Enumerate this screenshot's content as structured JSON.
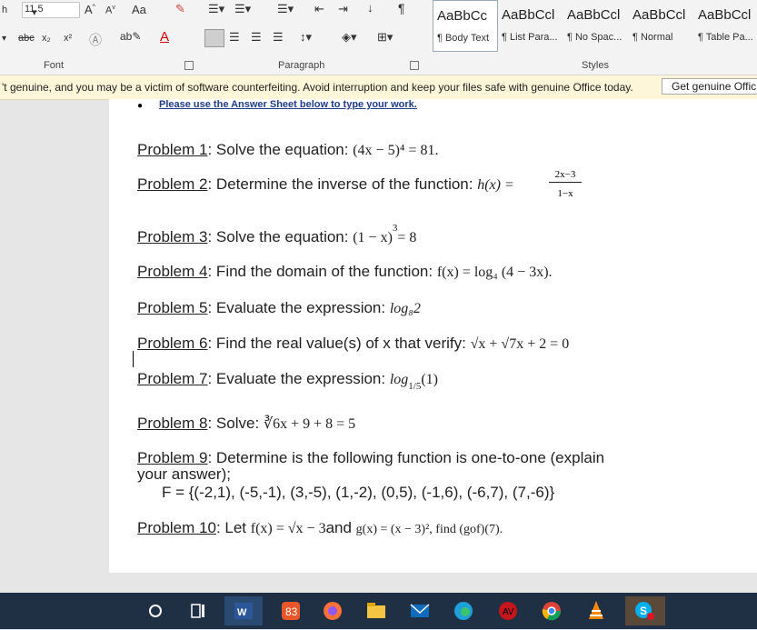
{
  "ribbon": {
    "font_size": "11.5",
    "aa_label": "Aa",
    "groups": {
      "font": "Font",
      "paragraph": "Paragraph",
      "styles": "Styles"
    },
    "styles": [
      {
        "preview": "AaBbCc",
        "name": "¶ Body Text"
      },
      {
        "preview": "AaBbCcl",
        "name": "¶ List Para..."
      },
      {
        "preview": "AaBbCcl",
        "name": "¶ No Spac..."
      },
      {
        "preview": "AaBbCcl",
        "name": "¶ Normal"
      },
      {
        "preview": "AaBbCcl",
        "name": "¶ Table Pa..."
      }
    ],
    "font_buttons": {
      "strike": "abc",
      "sub": "x₂",
      "sup": "x²",
      "font_color": "A"
    }
  },
  "message_bar": {
    "text": "'t genuine, and you may be a victim of software counterfeiting. Avoid interruption and keep your files safe with genuine Office today.",
    "button": "Get genuine Offic"
  },
  "document": {
    "instruction": "Please use the Answer Sheet below to type your work.",
    "problems": [
      {
        "label": "Problem 1",
        "text": ": Solve the equation: ",
        "math": "(4x − 5)⁴ = 81."
      },
      {
        "label": "Problem 2",
        "text": ": Determine the inverse of the function: ",
        "math": "h(x) =",
        "numerator": "2x−3",
        "denominator": "1−x"
      },
      {
        "label": "Problem 3",
        "text": ": Solve the equation: ",
        "math": "(1 − x)",
        "exponent": "3",
        "math2": "= 8"
      },
      {
        "label": "Problem 4",
        "text": ": Find the domain of the function: ",
        "math": "f(x) = log₄ (4 − 3x)."
      },
      {
        "label": "Problem 5",
        "text": ": Evaluate the expression: ",
        "math": "log₈2"
      },
      {
        "label": "Problem 6",
        "text": ": Find the real value(s) of x that verify: ",
        "math": "√x + √7x + 2 = 0"
      },
      {
        "label": "Problem 7",
        "text": ": Evaluate the expression: ",
        "math": "log",
        "subscript": "1/5",
        "math2": "(1)"
      },
      {
        "label": "Problem 8",
        "text": ": Solve: ",
        "math": "∛6x + 9 + 8 = 5"
      },
      {
        "label": "Problem 9",
        "text": ": Determine is the following function is one-to-one (explain",
        "text2": "your answer);",
        "set": "F = {(-2,1), (-5,-1), (3,-5), (1,-2), (0,5), (-1,6), (-6,7), (7,-6)}"
      },
      {
        "label": "Problem 10",
        "text": ": Let ",
        "math": "f(x) = √x − 3",
        "text2": "and ",
        "math2": "g(x) = (x − 3)², find (gof)(7)."
      }
    ]
  },
  "taskbar": {
    "icons": [
      "search-icon",
      "task-view-icon",
      "word-icon",
      "app-red-icon",
      "firefox-icon",
      "file-explorer-icon",
      "mail-icon",
      "edge-icon",
      "antivirus-icon",
      "chrome-icon",
      "vlc-icon",
      "skype-icon"
    ]
  },
  "colors": {
    "taskbar": "#1f2f44",
    "message_bar": "#fdf6d8",
    "ribbon": "#f3f3f3",
    "link": "#1f3c88"
  }
}
